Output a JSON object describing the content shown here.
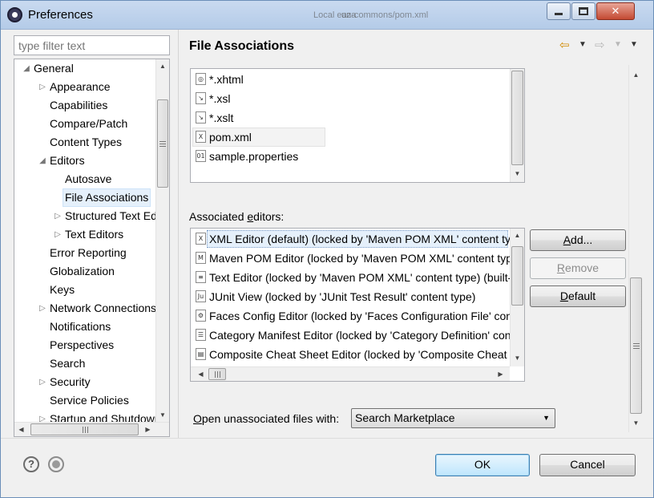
{
  "window": {
    "title": "Preferences",
    "background_tab": "un-commons/pom.xml",
    "background_tab_prefix": "Local eaza"
  },
  "filter": {
    "placeholder": "type filter text"
  },
  "tree": {
    "items": [
      {
        "label": "General",
        "expander": "expanded",
        "level": 0
      },
      {
        "label": "Appearance",
        "expander": "collapsed",
        "level": 1
      },
      {
        "label": "Capabilities",
        "expander": "none",
        "level": 1
      },
      {
        "label": "Compare/Patch",
        "expander": "none",
        "level": 1
      },
      {
        "label": "Content Types",
        "expander": "none",
        "level": 1
      },
      {
        "label": "Editors",
        "expander": "expanded",
        "level": 1
      },
      {
        "label": "Autosave",
        "expander": "none",
        "level": 2
      },
      {
        "label": "File Associations",
        "expander": "none",
        "level": 2,
        "selected": true
      },
      {
        "label": "Structured Text Editors",
        "expander": "collapsed",
        "level": 2
      },
      {
        "label": "Text Editors",
        "expander": "collapsed",
        "level": 2
      },
      {
        "label": "Error Reporting",
        "expander": "none",
        "level": 1
      },
      {
        "label": "Globalization",
        "expander": "none",
        "level": 1
      },
      {
        "label": "Keys",
        "expander": "none",
        "level": 1
      },
      {
        "label": "Network Connections",
        "expander": "collapsed",
        "level": 1
      },
      {
        "label": "Notifications",
        "expander": "none",
        "level": 1
      },
      {
        "label": "Perspectives",
        "expander": "none",
        "level": 1
      },
      {
        "label": "Search",
        "expander": "none",
        "level": 1
      },
      {
        "label": "Security",
        "expander": "collapsed",
        "level": 1
      },
      {
        "label": "Service Policies",
        "expander": "none",
        "level": 1
      },
      {
        "label": "Startup and Shutdown",
        "expander": "collapsed",
        "level": 1
      }
    ]
  },
  "page": {
    "title": "File Associations"
  },
  "file_types": {
    "items": [
      {
        "label": "*.xhtml",
        "icon": "web-file-icon"
      },
      {
        "label": "*.xsl",
        "icon": "xsl-file-icon"
      },
      {
        "label": "*.xslt",
        "icon": "xsl-file-icon"
      },
      {
        "label": "pom.xml",
        "icon": "xml-file-icon",
        "selected": true
      },
      {
        "label": "sample.properties",
        "icon": "properties-file-icon"
      }
    ]
  },
  "associated": {
    "label_prefix": "Associated ",
    "label_accel": "e",
    "label_suffix": "ditors:",
    "items": [
      {
        "label": "XML Editor (default) (locked by 'Maven POM XML' content type)",
        "icon": "xml-editor-icon",
        "glyph": "X",
        "selected": true
      },
      {
        "label": "Maven POM Editor (locked by 'Maven POM XML' content type)",
        "icon": "maven-editor-icon",
        "glyph": "M"
      },
      {
        "label": "Text Editor (locked by 'Maven POM XML' content type) (built-in)",
        "icon": "text-editor-icon",
        "glyph": "≡"
      },
      {
        "label": "JUnit View (locked by 'JUnit Test Result' content type)",
        "icon": "junit-icon",
        "glyph": "Ju"
      },
      {
        "label": "Faces Config Editor (locked by 'Faces Configuration File' content type)",
        "icon": "faces-config-icon",
        "glyph": "⚙"
      },
      {
        "label": "Category Manifest Editor (locked by 'Category Definition' content type)",
        "icon": "category-manifest-icon",
        "glyph": "☰"
      },
      {
        "label": "Composite Cheat Sheet Editor (locked by 'Composite Cheat Sheet' content type)",
        "icon": "cheat-sheet-icon",
        "glyph": "▤"
      }
    ]
  },
  "buttons": {
    "add": {
      "accel": "A",
      "rest": "dd..."
    },
    "remove": {
      "pre": "",
      "accel": "R",
      "rest": "emove"
    },
    "default": {
      "pre": "",
      "accel": "D",
      "rest": "efault"
    },
    "ok": "OK",
    "cancel": "Cancel"
  },
  "open_unassociated": {
    "label_accel": "O",
    "label_rest": "pen unassociated files with:",
    "value": "Search Marketplace"
  },
  "colors": {
    "selection": "#e5f0fb",
    "title_bar": "#c9daf0",
    "close_button": "#c44a33",
    "back_arrow": "#d18a00"
  }
}
